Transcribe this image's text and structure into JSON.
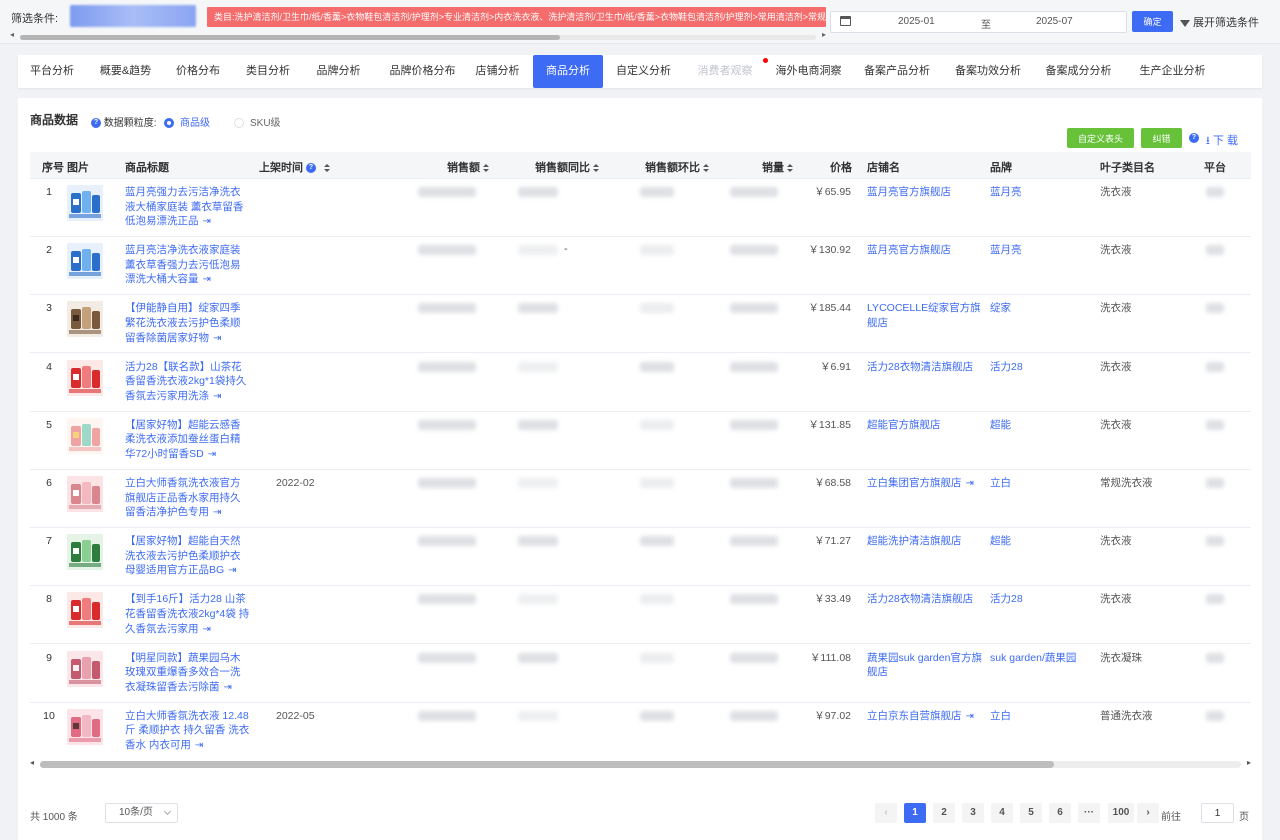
{
  "filter": {
    "label": "筛选条件:",
    "tag": "类目:洗护清洁剂/卫生巾/纸/香薰>衣物鞋包清洁剂/护理剂>专业清洁剂>内衣洗衣液、洗护清洁剂/卫生巾/纸/香薰>衣物鞋包清洁剂/护理剂>常用清洁剂>常规洗衣液",
    "date_start": "2025-01",
    "date_sep": "至",
    "date_end": "2025-07",
    "confirm": "确定",
    "expand": "展开筛选条件"
  },
  "tabs": [
    {
      "label": "平台分析"
    },
    {
      "label": "概要&趋势"
    },
    {
      "label": "价格分布"
    },
    {
      "label": "类目分析"
    },
    {
      "label": "品牌分析"
    },
    {
      "label": "品牌价格分布"
    },
    {
      "label": "店铺分析"
    },
    {
      "label": "商品分析",
      "active": true
    },
    {
      "label": "自定义分析"
    },
    {
      "label": "消费者观察",
      "disabled": true
    },
    {
      "label": "海外电商洞察"
    },
    {
      "label": "备案产品分析"
    },
    {
      "label": "备案功效分析"
    },
    {
      "label": "备案成分分析"
    },
    {
      "label": "生产企业分析"
    }
  ],
  "panel": {
    "title": "商品数据",
    "granularity_label": "数据颗粒度:",
    "option_product": "商品级",
    "option_sku": "SKU级",
    "custom_header": "自定义表头",
    "correct": "纠错",
    "download": "下 载"
  },
  "columns": {
    "idx": "序号",
    "image": "图片",
    "title": "商品标题",
    "listed": "上架时间",
    "sales": "销售额",
    "sales_yoy": "销售额同比",
    "sales_mom": "销售额环比",
    "volume": "销量",
    "price": "价格",
    "shop": "店铺名",
    "brand": "品牌",
    "leaf_cat": "叶子类目名",
    "platform": "平台"
  },
  "rows": [
    {
      "idx": "1",
      "title": "蓝月亮强力去污洁净洗衣液大桶家庭装 薰衣草留香低泡易漂洗正品",
      "date": "",
      "yoy_dash": "",
      "price": "￥65.95",
      "shop": "蓝月亮官方旗舰店",
      "shop_link": false,
      "brand": "蓝月亮",
      "cat": "洗衣液",
      "img": "blue"
    },
    {
      "idx": "2",
      "title": "蓝月亮洁净洗衣液家庭装 薰衣草香强力去污低泡易漂洗大桶大容量",
      "date": "",
      "yoy_dash": "-",
      "price": "￥130.92",
      "shop": "蓝月亮官方旗舰店",
      "shop_link": false,
      "brand": "蓝月亮",
      "cat": "洗衣液",
      "img": "blue"
    },
    {
      "idx": "3",
      "title": "【伊能静自用】绽家四季繁花洗衣液去污护色柔顺留香除菌居家好物",
      "date": "",
      "yoy_dash": "",
      "price": "￥185.44",
      "shop": "LYCOCELLE绽家官方旗舰店",
      "shop_link": false,
      "brand": "绽家",
      "cat": "洗衣液",
      "img": "brown"
    },
    {
      "idx": "4",
      "title": "活力28【联名款】山茶花香留香洗衣液2kg*1袋持久香氛去污家用洗涤",
      "date": "",
      "yoy_dash": "",
      "price": "￥6.91",
      "shop": "活力28衣物清洁旗舰店",
      "shop_link": false,
      "brand": "活力28",
      "cat": "洗衣液",
      "img": "red"
    },
    {
      "idx": "5",
      "title": "【居家好物】超能云感香柔洗衣液添加蚕丝蛋白精华72小时留香SD",
      "date": "",
      "yoy_dash": "",
      "price": "￥131.85",
      "shop": "超能官方旗舰店",
      "shop_link": false,
      "brand": "超能",
      "cat": "洗衣液",
      "img": "pastel"
    },
    {
      "idx": "6",
      "title": "立白大师香氛洗衣液官方旗舰店正品香水家用持久留香洁净护色专用",
      "date": "2022-02",
      "yoy_dash": "",
      "price": "￥68.58",
      "shop": "立白集团官方旗舰店",
      "shop_link": true,
      "brand": "立白",
      "cat": "常规洗衣液",
      "img": "pink"
    },
    {
      "idx": "7",
      "title": "【居家好物】超能自天然洗衣液去污护色柔顺护衣母婴适用官方正品BG",
      "date": "",
      "yoy_dash": "",
      "price": "￥71.27",
      "shop": "超能洗护清洁旗舰店",
      "shop_link": false,
      "brand": "超能",
      "cat": "洗衣液",
      "img": "green"
    },
    {
      "idx": "8",
      "title": "【到手16斤】活力28 山茶花香留香洗衣液2kg*4袋 持久香氛去污家用",
      "date": "",
      "yoy_dash": "",
      "price": "￥33.49",
      "shop": "活力28衣物清洁旗舰店",
      "shop_link": false,
      "brand": "活力28",
      "cat": "洗衣液",
      "img": "red"
    },
    {
      "idx": "9",
      "title": "【明星同款】蔬果园乌木玫瑰双重爆香多效合一洗衣凝珠留香去污除菌",
      "date": "",
      "yoy_dash": "",
      "price": "￥111.08",
      "shop": "蔬果园suk garden官方旗舰店",
      "shop_link": false,
      "brand": "suk garden/蔬果园",
      "cat": "洗衣凝珠",
      "img": "rose"
    },
    {
      "idx": "10",
      "title": "立白大师香氛洗衣液 12.48斤 柔顺护衣 持久留香 洗衣香水 内衣可用",
      "date": "2022-05",
      "yoy_dash": "",
      "price": "￥97.02",
      "shop": "立白京东自营旗舰店",
      "shop_link": true,
      "brand": "立白",
      "cat": "普通洗衣液",
      "img": "person"
    }
  ],
  "pagination": {
    "total": "共 1000 条",
    "page_size": "10条/页",
    "pages": [
      "1",
      "2",
      "3",
      "4",
      "5",
      "6",
      "···",
      "100"
    ],
    "goto_label": "前往",
    "goto_value": "1",
    "goto_suffix": "页"
  },
  "colors": {
    "accent": "#3e6bf4",
    "green_button": "#67c23a",
    "filter_tag": "#f56c6c"
  }
}
